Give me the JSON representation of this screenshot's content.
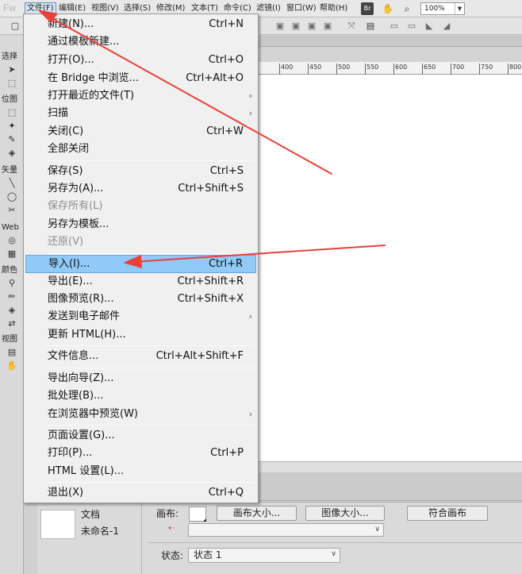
{
  "app": {
    "logo": "Fw"
  },
  "menubar": {
    "items": [
      "文件(F)",
      "编辑(E)",
      "视图(V)",
      "选择(S)",
      "修改(M)",
      "文本(T)",
      "命令(C)",
      "滤镜(I)",
      "窗口(W)",
      "帮助(H)"
    ],
    "zoom": "100%"
  },
  "tools": {
    "headers": [
      "选择",
      "位图",
      "矢量",
      "Web",
      "颜色",
      "视图"
    ]
  },
  "ruler": {
    "ticks": [
      "400",
      "450",
      "500",
      "550",
      "600",
      "650",
      "700",
      "750",
      "800"
    ]
  },
  "file_menu": {
    "items": [
      {
        "label": "新建(N)...",
        "shortcut": "Ctrl+N"
      },
      {
        "label": "通过模板新建...",
        "shortcut": ""
      },
      {
        "label": "打开(O)...",
        "shortcut": "Ctrl+O"
      },
      {
        "label": "在 Bridge 中浏览...",
        "shortcut": "Ctrl+Alt+O"
      },
      {
        "label": "打开最近的文件(T)",
        "shortcut": ""
      },
      {
        "label": "扫描",
        "shortcut": ""
      },
      {
        "label": "关闭(C)",
        "shortcut": "Ctrl+W"
      },
      {
        "label": "全部关闭",
        "shortcut": ""
      },
      {
        "label": "保存(S)",
        "shortcut": "Ctrl+S"
      },
      {
        "label": "另存为(A)...",
        "shortcut": "Ctrl+Shift+S"
      },
      {
        "label": "保存所有(L)",
        "shortcut": ""
      },
      {
        "label": "另存为模板...",
        "shortcut": ""
      },
      {
        "label": "还原(V)",
        "shortcut": ""
      },
      {
        "label": "导入(I)...",
        "shortcut": "Ctrl+R"
      },
      {
        "label": "导出(E)...",
        "shortcut": "Ctrl+Shift+R"
      },
      {
        "label": "图像预览(R)...",
        "shortcut": "Ctrl+Shift+X"
      },
      {
        "label": "发送到电子邮件",
        "shortcut": ""
      },
      {
        "label": "更新 HTML(H)...",
        "shortcut": ""
      },
      {
        "label": "文件信息...",
        "shortcut": "Ctrl+Alt+Shift+F"
      },
      {
        "label": "导出向导(Z)...",
        "shortcut": ""
      },
      {
        "label": "批处理(B)...",
        "shortcut": ""
      },
      {
        "label": "在浏览器中预览(W)",
        "shortcut": ""
      },
      {
        "label": "页面设置(G)...",
        "shortcut": ""
      },
      {
        "label": "打印(P)...",
        "shortcut": "Ctrl+P"
      },
      {
        "label": "HTML 设置(L)...",
        "shortcut": ""
      },
      {
        "label": "退出(X)",
        "shortcut": "Ctrl+Q"
      }
    ],
    "submenu_arrow": "›"
  },
  "properties": {
    "doc_type": "文档",
    "doc_name": "未命名-1",
    "canvas_label": "画布:",
    "canvas_size_button": "画布大小...",
    "image_size_button": "图像大小...",
    "fit_canvas_button": "符合画布",
    "state_label": "状态:",
    "state_value": "状态 1"
  },
  "colors": {
    "highlight": "#91c9f7",
    "arrow": "#e8413a"
  }
}
